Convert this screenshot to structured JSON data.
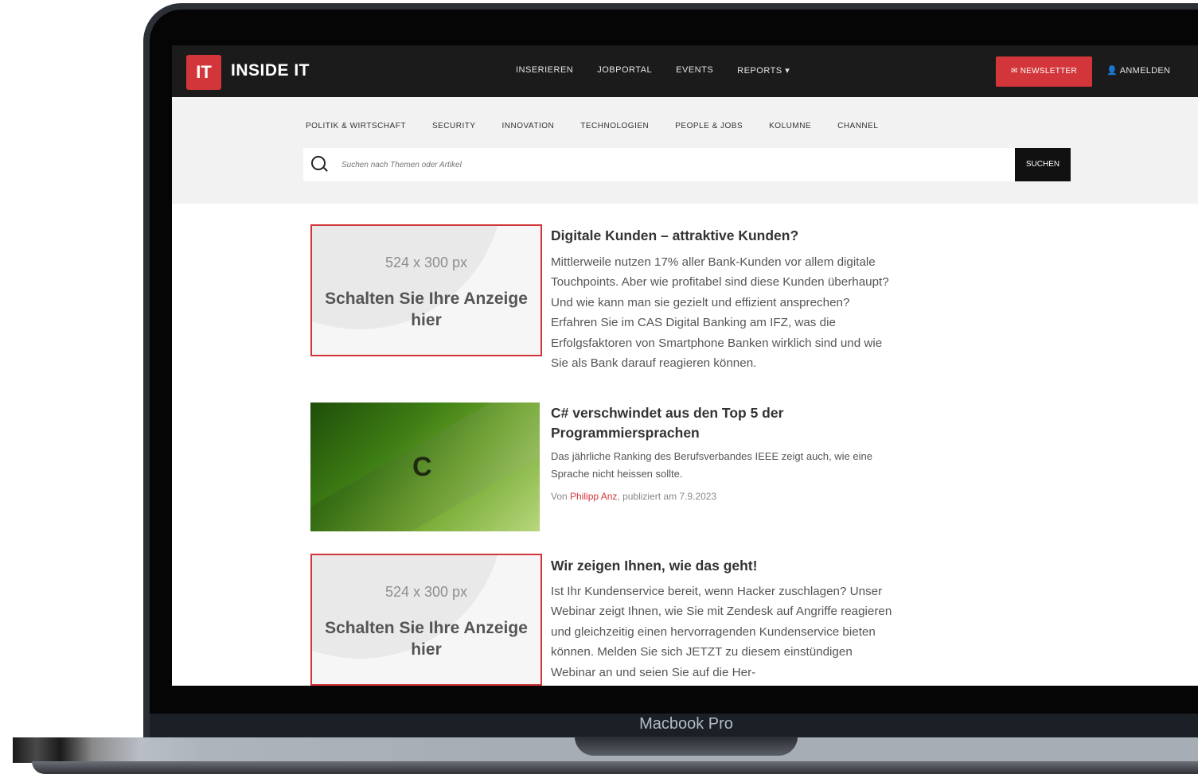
{
  "device": {
    "model_label": "Macbook Pro"
  },
  "header": {
    "logo_mark": "IT",
    "logo_text": "INSIDE IT",
    "nav": [
      "INSERIEREN",
      "JOBPORTAL",
      "EVENTS",
      "REPORTS"
    ],
    "newsletter_label": "✉ NEWSLETTER",
    "login_label": "ANMELDEN"
  },
  "categories": [
    "POLITIK & WIRTSCHAFT",
    "SECURITY",
    "INNOVATION",
    "TECHNOLOGIEN",
    "PEOPLE & JOBS",
    "KOLUMNE",
    "CHANNEL"
  ],
  "search": {
    "placeholder": "Suchen nach Themen oder Artikel",
    "button_label": "SUCHEN"
  },
  "articles": [
    {
      "type": "ad",
      "ad_size": "524 x 300 px",
      "ad_cta": "Schalten Sie Ihre Anzeige hier",
      "title": "Digitale Kunden – attraktive Kunden?",
      "body": "Mittlerweile nutzen 17% aller Bank-Kunden vor allem digitale Touchpoints. Aber wie profitabel sind diese Kunden überhaupt? Und wie kann man sie gezielt und effizient ansprechen? Erfahren Sie im CAS Digital Banking am IFZ, was die Erfolgsfaktoren von Smartphone Banken wirklich sind und wie Sie als Bank darauf reagieren können."
    },
    {
      "type": "news",
      "thumb_letter": "C",
      "title": "C# verschwindet aus den Top 5 der Programmiersprachen",
      "body": "Das jährliche Ranking des Berufsverbandes IEEE zeigt auch, wie eine Sprache nicht heissen sollte.",
      "byline_prefix": "Von ",
      "author": "Philipp Anz",
      "byline_suffix": ", publiziert am 7.9.2023"
    },
    {
      "type": "ad",
      "ad_size": "524 x 300 px",
      "ad_cta": "Schalten Sie Ihre Anzeige hier",
      "title": "Wir zeigen Ihnen, wie das geht!",
      "body": "Ist Ihr Kundenservice bereit, wenn Hacker zuschlagen? Unser Webinar zeigt Ihnen, wie Sie mit Zendesk auf Angriffe reagieren und gleichzeitig einen hervorragenden Kundenservice bieten können. Melden Sie sich JETZT zu diesem einstündigen Webinar an und seien Sie auf die Her-"
    }
  ],
  "colors": {
    "brand_red": "#d2363a",
    "topbar": "#1b1b1b",
    "subbar": "#f2f2f2"
  }
}
